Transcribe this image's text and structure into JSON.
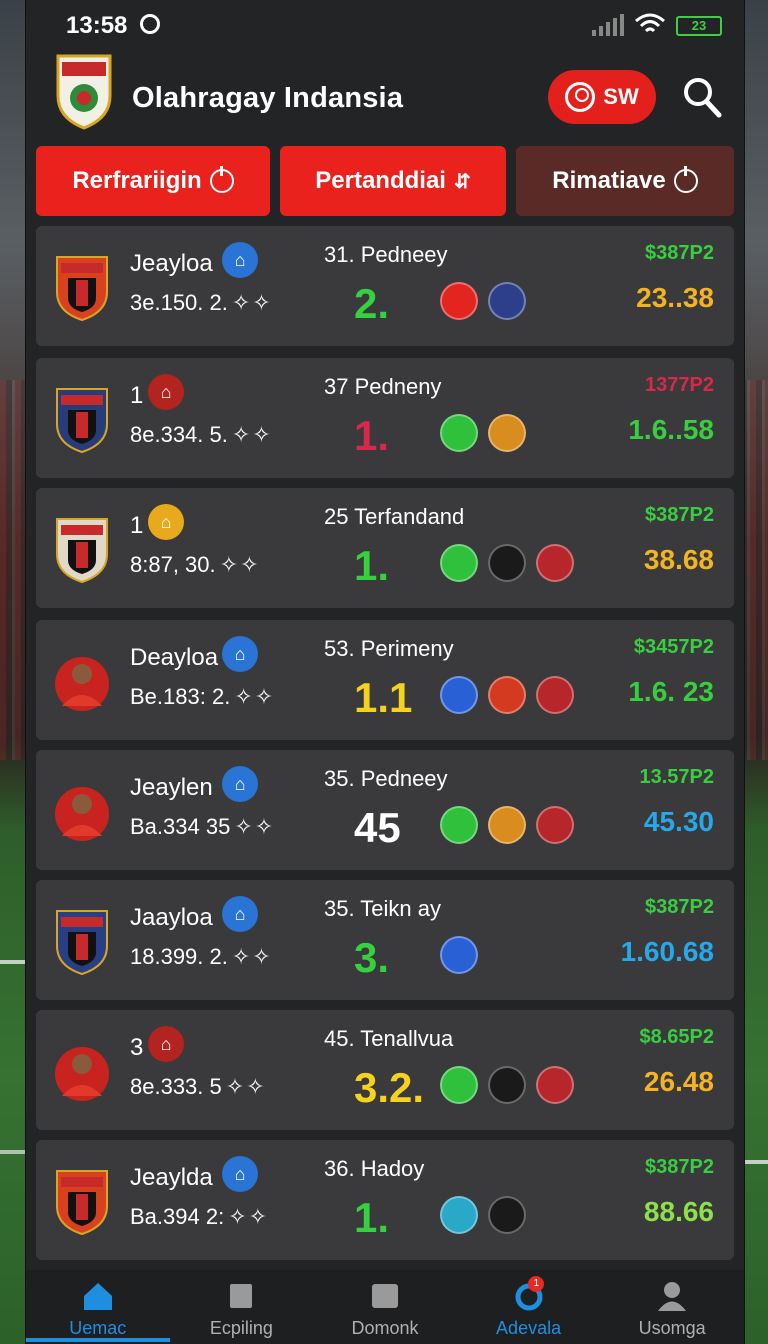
{
  "status_bar": {
    "time": "13:58",
    "battery": "23"
  },
  "header": {
    "title": "Olahragay Indansia",
    "sw_label": "SW"
  },
  "tabs": [
    {
      "label": "Rerfrariigin",
      "style": "red"
    },
    {
      "label": "Pertanddiai",
      "style": "red"
    },
    {
      "label": "Rimatiave",
      "style": "dark"
    }
  ],
  "matches": [
    {
      "name": "Jeayloa",
      "name_icon_color": "#2a74d6",
      "stat": "3e.150. 2.",
      "league": "31. Pedneey",
      "score": "2.",
      "score_color": "#36d13e",
      "badges": [
        "#e3241f",
        "#2d3f8a"
      ],
      "odds": "$387P2",
      "odds_color": "#37cf3f",
      "value": "23..38",
      "value_color": "#f4b323"
    },
    {
      "name": "1",
      "name_icon_color": "#b3231f",
      "stat": "8e.334. 5.",
      "league": "37 Pedneny",
      "score": "1.",
      "score_color": "#d8294a",
      "badges": [
        "#2fc13c",
        "#d98d1f"
      ],
      "odds": "1377P2",
      "odds_color": "#d8294a",
      "value": "1.6..58",
      "value_color": "#37cf3f"
    },
    {
      "name": "1",
      "name_icon_color": "#e9a91c",
      "stat": "8:87, 30.",
      "league": "25 Terfandand",
      "score": "1.",
      "score_color": "#36d13e",
      "badges": [
        "#2fc13c",
        "#1a1a1a",
        "#b6262a"
      ],
      "odds": "$387P2",
      "odds_color": "#37cf3f",
      "value": "38.68",
      "value_color": "#f4b323"
    },
    {
      "name": "Deayloa",
      "name_icon_color": "#2a74d6",
      "stat": "Be.183: 2.",
      "league": "53. Perimeny",
      "score": "1.1",
      "score_color": "#f4d21e",
      "badges": [
        "#2a60d6",
        "#d43a1f",
        "#b6262a"
      ],
      "odds": "$3457P2",
      "odds_color": "#37cf3f",
      "value": "1.6. 23",
      "value_color": "#37cf3f"
    },
    {
      "name": "Jeaylen",
      "name_icon_color": "#2a74d6",
      "stat": "Ba.334 35",
      "league": "35. Pedneey",
      "score": "45",
      "score_color": "#ffffff",
      "badges": [
        "#2fc13c",
        "#d98d1f",
        "#b6262a"
      ],
      "odds": "13.57P2",
      "odds_color": "#37cf3f",
      "value": "45.30",
      "value_color": "#27a8e8"
    },
    {
      "name": "Jaayloa",
      "name_icon_color": "#2a74d6",
      "stat": "18.399. 2.",
      "league": "35. Teikn ay",
      "score": "3.",
      "score_color": "#36d13e",
      "badges": [
        "#2a60d6"
      ],
      "odds": "$387P2",
      "odds_color": "#37cf3f",
      "value": "1.60.68",
      "value_color": "#27a8e8"
    },
    {
      "name": "3",
      "name_icon_color": "#b3231f",
      "stat": "8e.333. 5",
      "league": "45. Tenallvua",
      "score": "3.2.",
      "score_color": "#f4d21e",
      "badges": [
        "#2fc13c",
        "#1a1a1a",
        "#b6262a"
      ],
      "odds": "$8.65P2",
      "odds_color": "#37cf3f",
      "value": "26.48",
      "value_color": "#f4b323"
    },
    {
      "name": "Jeaylda",
      "name_icon_color": "#2a74d6",
      "stat": "Ba.394 2:",
      "league": "36. Hadoy",
      "score": "1.",
      "score_color": "#36d13e",
      "badges": [
        "#2aa8c8",
        "#1a1a1a"
      ],
      "odds": "$387P2",
      "odds_color": "#37cf3f",
      "value": "88.66",
      "value_color": "#8ee04a"
    }
  ],
  "bottom_nav": [
    {
      "label": "Uemac",
      "icon": "home-icon",
      "state": "active"
    },
    {
      "label": "Ecpiling",
      "icon": "ball-icon",
      "state": ""
    },
    {
      "label": "Domonk",
      "icon": "card-icon",
      "state": ""
    },
    {
      "label": "Adevala",
      "icon": "ring-icon",
      "state": "blue",
      "badge": "1"
    },
    {
      "label": "Usomga",
      "icon": "user-icon",
      "state": ""
    }
  ]
}
